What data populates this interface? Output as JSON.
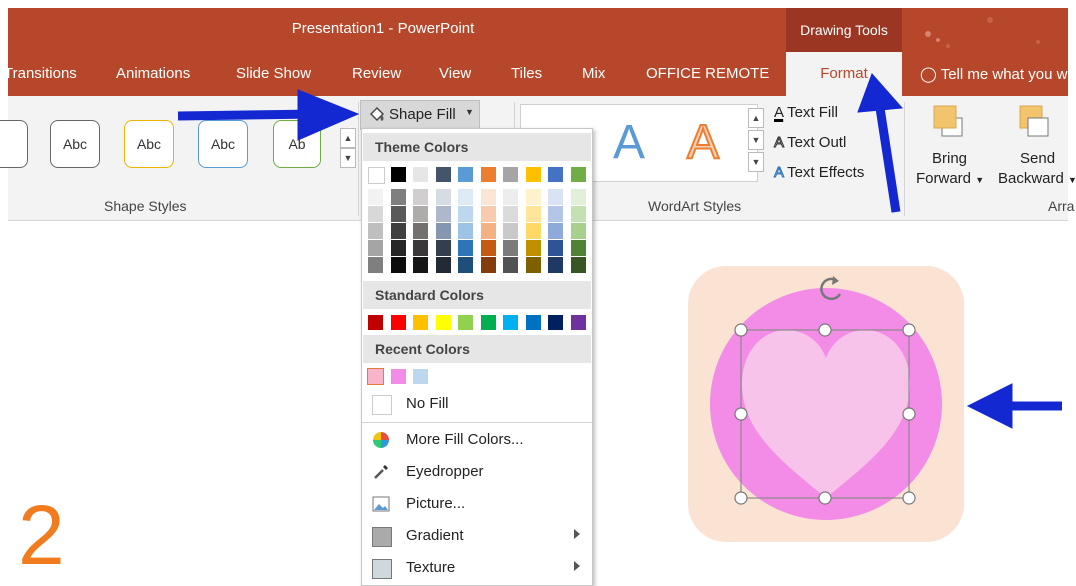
{
  "window": {
    "title": "Presentation1 - PowerPoint",
    "context_tab_group": "Drawing Tools"
  },
  "tabs": [
    {
      "label": "Transitions"
    },
    {
      "label": "Animations"
    },
    {
      "label": "Slide Show"
    },
    {
      "label": "Review"
    },
    {
      "label": "View"
    },
    {
      "label": "Tiles"
    },
    {
      "label": "Mix"
    },
    {
      "label": "OFFICE REMOTE"
    }
  ],
  "format_tab": {
    "label": "Format"
  },
  "tell_me": {
    "label": "Tell me what you w"
  },
  "shape_styles": {
    "group_label": "Shape Styles",
    "thumbs": [
      {
        "label": "Abc",
        "border": "#666666"
      },
      {
        "label": "Abc",
        "border": "#f0b400"
      },
      {
        "label": "Abc",
        "border": "#5b9bd5"
      },
      {
        "label": "Ab",
        "border": "#70ad47"
      }
    ]
  },
  "shape_fill": {
    "label": "Shape Fill"
  },
  "wordart": {
    "group_label": "WordArt Styles",
    "sample_blue": "A",
    "sample_orange": "A",
    "text_fill": "Text Fill",
    "text_outline": "Text Outl",
    "text_effects": "Text Effects"
  },
  "arrange": {
    "bring_forward_line1": "Bring",
    "bring_forward_line2": "Forward",
    "send_backward_line1": "Send",
    "send_backward_line2": "Backward",
    "group_label": "Arra"
  },
  "dropdown": {
    "theme_colors_header": "Theme Colors",
    "theme_top_row": [
      "#ffffff",
      "#000000",
      "#e7e6e6",
      "#44546a",
      "#5b9bd5",
      "#ed7d31",
      "#a5a5a5",
      "#ffc000",
      "#4472c4",
      "#70ad47"
    ],
    "theme_shades": [
      [
        "#f2f2f2",
        "#7f7f7f",
        "#d0cece",
        "#d6dce4",
        "#deebf6",
        "#fbe5d5",
        "#ededed",
        "#fff2cc",
        "#dae3f3",
        "#e2efd9"
      ],
      [
        "#d8d8d8",
        "#595959",
        "#aeabab",
        "#adb9ca",
        "#bdd7ee",
        "#f7cbac",
        "#dbdbdb",
        "#fee599",
        "#b4c6e7",
        "#c5e0b3"
      ],
      [
        "#bfbfbf",
        "#3f3f3f",
        "#757070",
        "#8496b0",
        "#9dc3e6",
        "#f4b183",
        "#c9c9c9",
        "#ffd965",
        "#8eaadb",
        "#a8d08d"
      ],
      [
        "#a5a5a5",
        "#262626",
        "#3a3838",
        "#323f4f",
        "#2e75b5",
        "#c55a11",
        "#7b7b7b",
        "#bf9000",
        "#2f5496",
        "#538135"
      ],
      [
        "#7f7f7f",
        "#0c0c0c",
        "#171616",
        "#222a35",
        "#1e4e79",
        "#833c0b",
        "#525252",
        "#7f6000",
        "#1f3864",
        "#375623"
      ]
    ],
    "standard_colors_header": "Standard Colors",
    "standard_colors": [
      "#c00000",
      "#ff0000",
      "#ffc000",
      "#ffff00",
      "#92d050",
      "#00b050",
      "#00b0f0",
      "#0070c0",
      "#002060",
      "#7030a0"
    ],
    "recent_colors_header": "Recent Colors",
    "recent_colors": [
      "#f8b4c8",
      "#f28ce6",
      "#bdd7ee"
    ],
    "no_fill": "No Fill",
    "menu_items": [
      {
        "label": "More Fill Colors...",
        "icon": "color-wheel-icon",
        "submenu": false
      },
      {
        "label": "Eyedropper",
        "icon": "eyedropper-icon",
        "submenu": false
      },
      {
        "label": "Picture...",
        "icon": "picture-icon",
        "submenu": false
      },
      {
        "label": "Gradient",
        "icon": "gradient-icon",
        "submenu": true
      },
      {
        "label": "Texture",
        "icon": "texture-icon",
        "submenu": true
      }
    ]
  },
  "slide": {
    "number_label": "2"
  },
  "colors": {
    "accent": "#b7472a",
    "annotation_arrow": "#1428d2",
    "tile_bg": "#fbe3d4",
    "circle_fill": "#f28ce6",
    "heart_fill": "#f8c3ea"
  }
}
